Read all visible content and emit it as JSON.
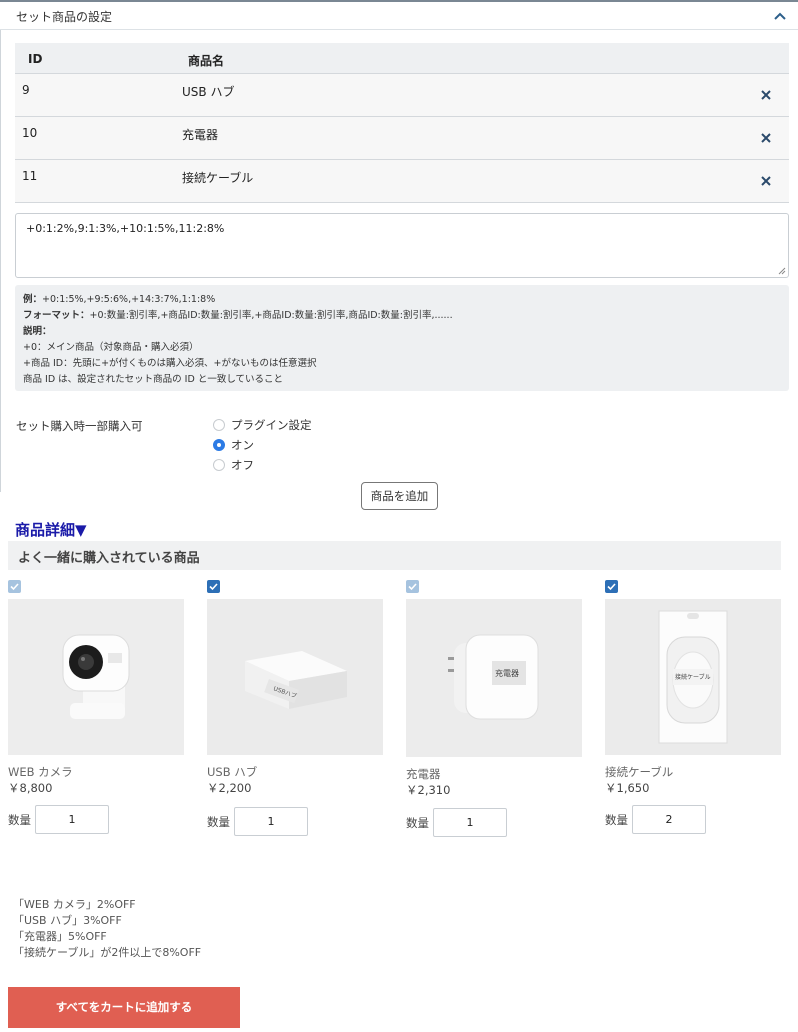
{
  "panel": {
    "title": "セット商品の設定",
    "table": {
      "headers": [
        "ID",
        "商品名"
      ],
      "rows": [
        {
          "id": "9",
          "name": "USB ハブ"
        },
        {
          "id": "10",
          "name": "充電器"
        },
        {
          "id": "11",
          "name": "接続ケーブル"
        }
      ]
    },
    "textarea_value": "+0:1:2%,9:1:3%,+10:1:5%,11:2:8%",
    "help": {
      "example_label": "例：",
      "example": "+0:1:5%,+9:5:6%,+14:3:7%,1:1:8%",
      "format_label": "フォーマット：",
      "format": "+0:数量:割引率,+商品ID:数量:割引率,+商品ID:数量:割引率,商品ID:数量:割引率,......",
      "desc_label": "説明：",
      "desc_lines": [
        "+0：メイン商品（対象商品・購入必須）",
        "+商品 ID：先頭に+が付くものは購入必須、+がないものは任意選択",
        "商品 ID は、設定されたセット商品の ID と一致していること"
      ]
    },
    "partial_purchase": {
      "label": "セット購入時一部購入可",
      "options": [
        "プラグイン設定",
        "オン",
        "オフ"
      ],
      "selected": "オン"
    },
    "add_button": "商品を追加"
  },
  "detail": {
    "title": "商品詳細▼",
    "bundle_title": "よく一緒に購入されている商品",
    "products": [
      {
        "name": "WEB カメラ",
        "price": "￥8,800",
        "qty": "1",
        "checked": true,
        "check_style": "light",
        "image_label": ""
      },
      {
        "name": "USB ハブ",
        "price": "￥2,200",
        "qty": "1",
        "checked": true,
        "check_style": "solid",
        "image_label": "USBハブ"
      },
      {
        "name": "充電器",
        "price": "￥2,310",
        "qty": "1",
        "checked": true,
        "check_style": "light",
        "image_label": "充電器"
      },
      {
        "name": "接続ケーブル",
        "price": "￥1,650",
        "qty": "2",
        "checked": true,
        "check_style": "solid",
        "image_label": "接続ケーブル"
      }
    ],
    "qty_label": "数量",
    "discounts": [
      "「WEB カメラ」2%OFF",
      "「USB ハブ」3%OFF",
      "「充電器」5%OFF",
      "「接続ケーブル」が2件以上で8%OFF"
    ],
    "cart_button": "すべてをカートに追加する"
  },
  "colors": {
    "accent_blue": "#2c7be5",
    "detail_title": "#1a1aa8",
    "cart_button": "#e05f52",
    "check_solid": "#2d6fb6",
    "check_light": "#a6c3df"
  }
}
